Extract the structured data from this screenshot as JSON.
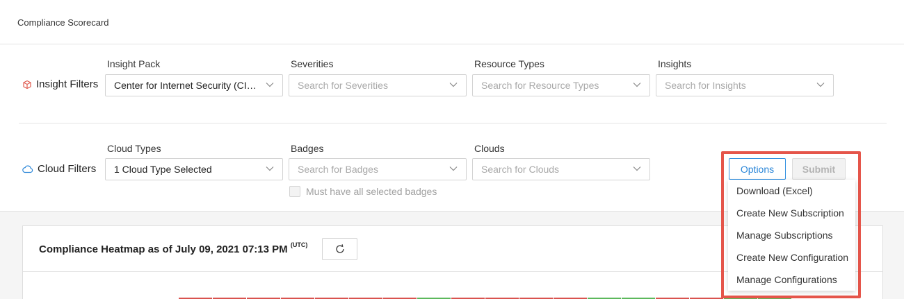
{
  "header": {
    "title": "Compliance Scorecard"
  },
  "insight_filters": {
    "label": "Insight Filters",
    "fields": [
      {
        "label": "Insight Pack",
        "value": "Center for Internet Security (CIS) …",
        "placeholder": ""
      },
      {
        "label": "Severities",
        "value": "",
        "placeholder": "Search for Severities"
      },
      {
        "label": "Resource Types",
        "value": "",
        "placeholder": "Search for Resource Types"
      },
      {
        "label": "Insights",
        "value": "",
        "placeholder": "Search for Insights"
      }
    ]
  },
  "cloud_filters": {
    "label": "Cloud Filters",
    "fields": [
      {
        "label": "Cloud Types",
        "value": "1 Cloud Type Selected",
        "placeholder": ""
      },
      {
        "label": "Badges",
        "value": "",
        "placeholder": "Search for Badges"
      },
      {
        "label": "Clouds",
        "value": "",
        "placeholder": "Search for Clouds"
      }
    ],
    "badges_checkbox_label": "Must have all selected badges"
  },
  "actions": {
    "options_label": "Options",
    "submit_label": "Submit"
  },
  "options_menu": {
    "items": [
      "Download (Excel)",
      "Create New Subscription",
      "Manage Subscriptions",
      "Create New Configuration",
      "Manage Configurations"
    ]
  },
  "heatmap": {
    "title": "Compliance Heatmap as of July 09, 2021 07:13 PM",
    "tz": "(UTC)",
    "cell_colors": [
      "#d9534f",
      "#d9534f",
      "#d9534f",
      "#d9534f",
      "#d9534f",
      "#d9534f",
      "#d9534f",
      "#5cb85c",
      "#d9534f",
      "#d9534f",
      "#d9534f",
      "#d9534f",
      "#5cb85c",
      "#5cb85c",
      "#d9534f",
      "#d9534f",
      "#5cb85c",
      "#5cb85c"
    ]
  },
  "colors": {
    "accent": "#2a86d8",
    "highlight": "#e5554a",
    "fail": "#d9534f",
    "pass": "#5cb85c"
  }
}
